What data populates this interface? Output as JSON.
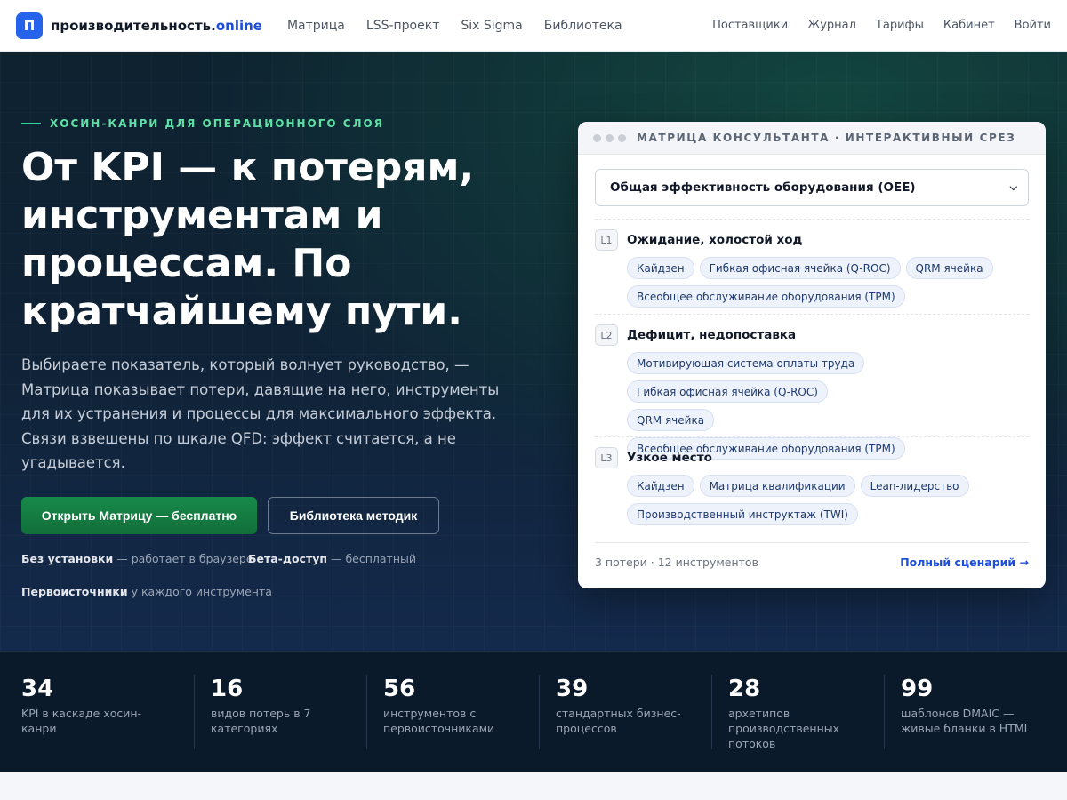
{
  "nav": {
    "logo_letter": "П",
    "brand_main": "производительность.",
    "brand_tld": "online",
    "left_links": [
      "Матрица",
      "LSS-проект",
      "Six Sigma",
      "Библиотека"
    ],
    "right_links": [
      "Поставщики",
      "Журнал",
      "Тарифы",
      "Кабинет",
      "Войти"
    ]
  },
  "hero": {
    "eyebrow": "ХОСИН-КАНРИ ДЛЯ ОПЕРАЦИОННОГО СЛОЯ",
    "title": "От KPI — к потерям, инструментам и процессам. По кратчайшему пути.",
    "description": "Выбираете показатель, который волнует руководство, — Матрица показывает потери, давящие на него, инструменты для их устранения и процессы для максимального эффекта. Связи взвешены по шкале QFD: эффект считается, а не угадывается.",
    "primary_button": "Открыть Матрицу — бесплатно",
    "secondary_button": "Библиотека методик",
    "features": [
      {
        "bold": "Без установки",
        "rest": " — работает в браузере"
      },
      {
        "bold": "Бета-доступ",
        "rest": " — бесплатный"
      },
      {
        "bold": "Первоисточники",
        "rest": " у каждого инструмента"
      }
    ]
  },
  "matrix_card": {
    "header": "МАТРИЦА КОНСУЛЬТАНТА · ИНТЕРАКТИВНЫЙ СРЕЗ",
    "selected_kpi": "Общая эффективность оборудования (OEE)",
    "losses": [
      {
        "level": "L1",
        "name": "Ожидание, холостой ход",
        "tools": [
          "Кайдзен",
          "Гибкая офисная ячейка (Q-ROC)",
          "QRM ячейка",
          "Всеобщее обслуживание оборудования (TPM)"
        ]
      },
      {
        "level": "L2",
        "name": "Дефицит, недопоставка",
        "tools": [
          "Мотивирующая система оплаты труда",
          "Гибкая офисная ячейка (Q-ROC)",
          "QRM ячейка",
          "Всеобщее обслуживание оборудования (TPM)"
        ]
      },
      {
        "level": "L3",
        "name": "Узкое место",
        "tools": [
          "Кайдзен",
          "Матрица квалификации",
          "Lean-лидерство",
          "Производственный инструктаж (TWI)"
        ]
      }
    ],
    "footer_summary": "3 потери · 12 инструментов",
    "footer_link": "Полный сценарий →"
  },
  "stats": [
    {
      "value": "34",
      "label": "KPI в каскаде хосин-канри"
    },
    {
      "value": "16",
      "label": "видов потерь в 7 категориях"
    },
    {
      "value": "56",
      "label": "инструментов с первоисточниками"
    },
    {
      "value": "39",
      "label": "стандартных бизнес-процессов"
    },
    {
      "value": "28",
      "label": "архетипов производственных потоков"
    },
    {
      "value": "99",
      "label": "шаблонов DMAIC — живые бланки в HTML"
    }
  ],
  "colors": {
    "accent_blue": "#2563eb",
    "accent_green": "#16a34a",
    "eyebrow_green": "#5ee0a6",
    "hero_dark": "#0f2236"
  }
}
